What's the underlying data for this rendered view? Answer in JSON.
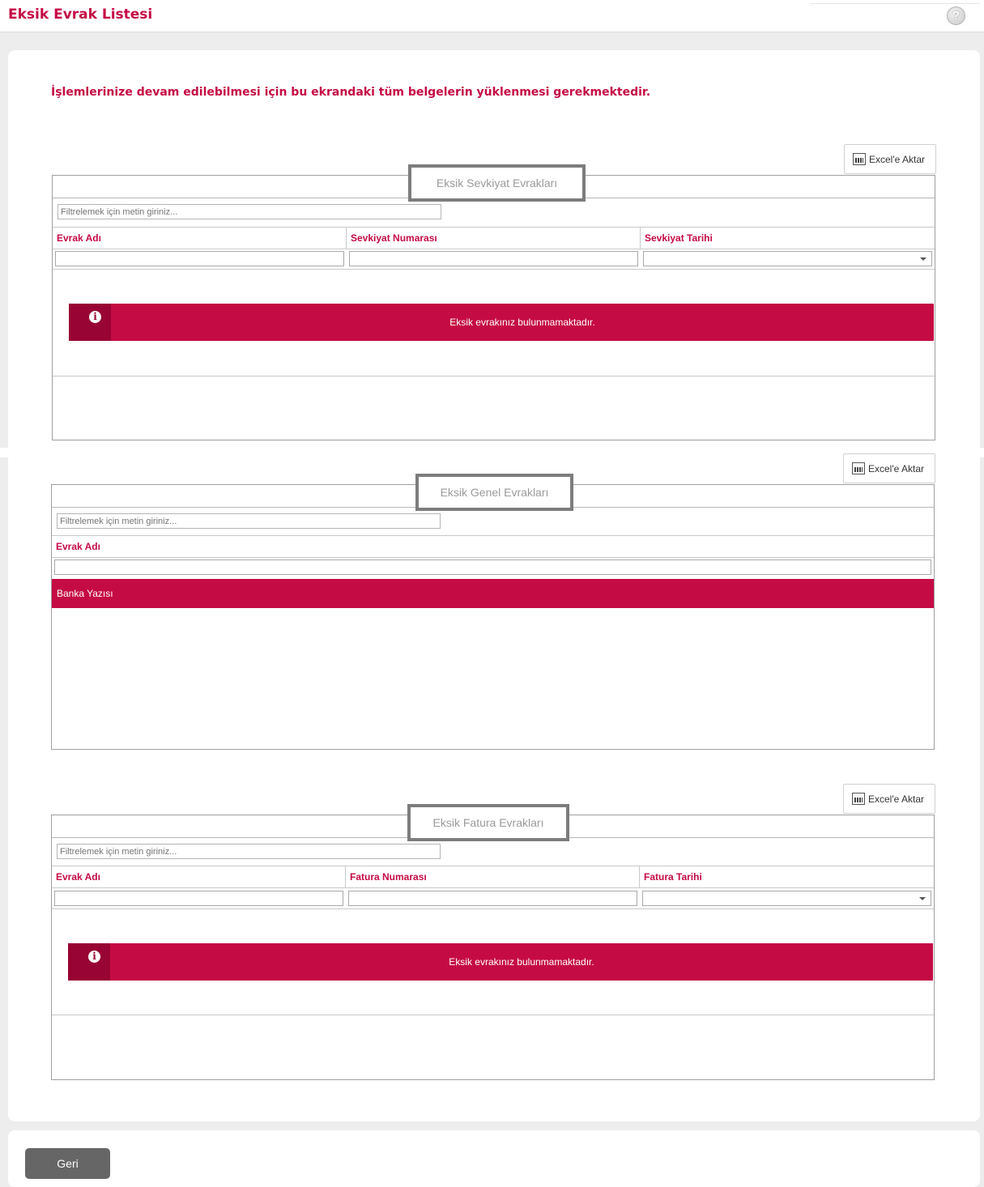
{
  "header": {
    "title": "Eksik Evrak Listesi",
    "help_icon": "?"
  },
  "warning": "İşlemlerinize devam edilebilmesi için bu ekrandaki tüm belgelerin yüklenmesi gerekmektedir.",
  "grids": {
    "shipment": {
      "export_label": "Excel'e Aktar",
      "title": "Eksik Sevkiyat Evrakları",
      "filter_placeholder": "Filtrelemek için metin giriniz...",
      "columns": [
        "Evrak Adı",
        "Sevkiyat Numarası",
        "Sevkiyat Tarihi"
      ],
      "empty_message": "Eksik evrakınız bulunmamaktadır."
    },
    "general": {
      "export_label": "Excel'e Aktar",
      "title": "Eksik Genel Evrakları",
      "filter_placeholder": "Filtrelemek için metin giriniz...",
      "columns": [
        "Evrak Adı"
      ],
      "rows": [
        "Banka Yazısı"
      ]
    },
    "invoice": {
      "export_label": "Excel'e Aktar",
      "title": "Eksik Fatura Evrakları",
      "filter_placeholder": "Filtrelemek için metin giriniz...",
      "columns": [
        "Evrak Adı",
        "Fatura Numarası",
        "Fatura Tarihi"
      ],
      "empty_message": "Eksik evrakınız bulunmamaktadır."
    }
  },
  "footer": {
    "back_label": "Geri"
  },
  "colors": {
    "accent": "#c50b44",
    "accent_dark": "#980433",
    "button_gray": "#666666"
  },
  "icons": {
    "help": "help-icon",
    "excel": "excel-icon",
    "info": "info-icon",
    "dropdown": "chevron-down-icon"
  }
}
